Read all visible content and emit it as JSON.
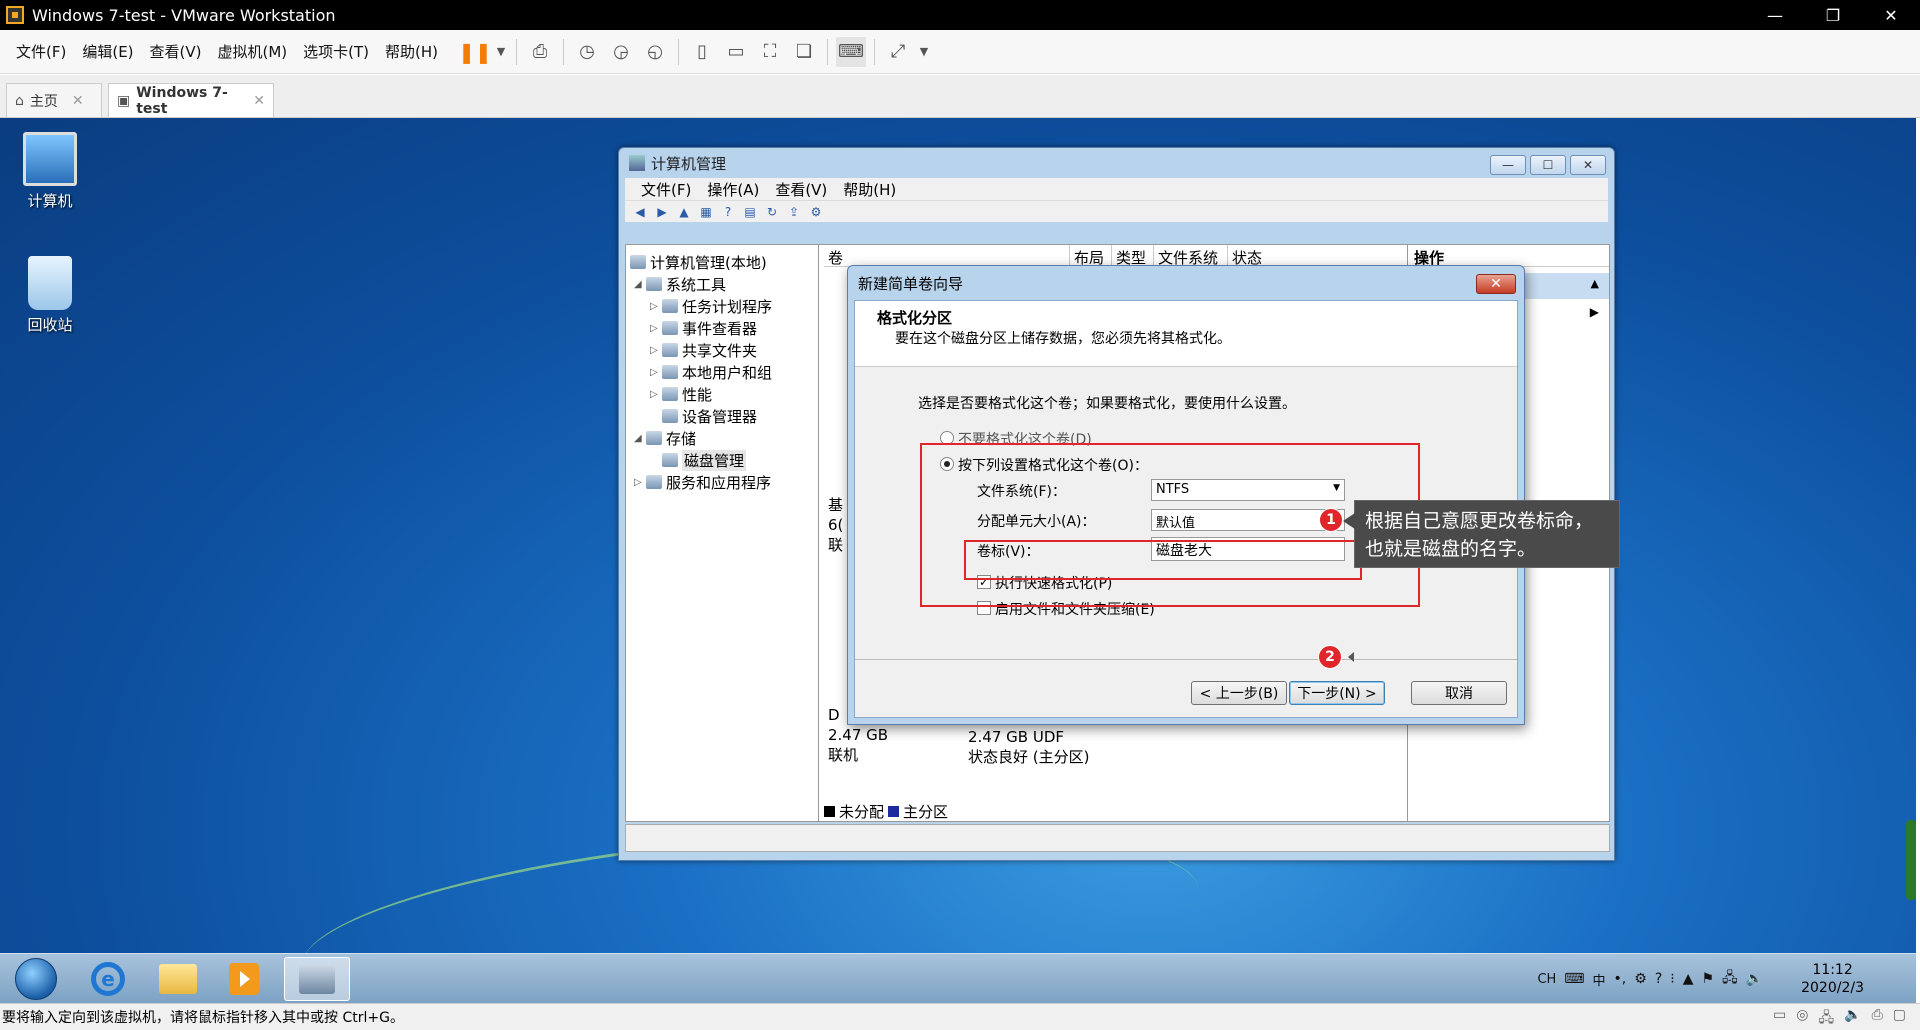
{
  "vmware": {
    "title": "Windows 7-test - VMware Workstation",
    "menu": [
      "文件(F)",
      "编辑(E)",
      "查看(V)",
      "虚拟机(M)",
      "选项卡(T)",
      "帮助(H)"
    ],
    "tabs": {
      "home": "主页",
      "vm": "Windows 7-test"
    },
    "status_message": "要将输入定向到该虚拟机，请将鼠标指针移入其中或按 Ctrl+G。"
  },
  "desktop": {
    "icons": {
      "computer": "计算机",
      "recycle_bin": "回收站"
    }
  },
  "taskbar": {
    "tray_lang": "CH",
    "ime": "中",
    "time": "11:12",
    "date": "2020/2/3"
  },
  "cm": {
    "title": "计算机管理",
    "menu": [
      "文件(F)",
      "操作(A)",
      "查看(V)",
      "帮助(H)"
    ],
    "tree": {
      "root": "计算机管理(本地)",
      "system_tools": "系统工具",
      "task_scheduler": "任务计划程序",
      "event_viewer": "事件查看器",
      "shared_folders": "共享文件夹",
      "local_users": "本地用户和组",
      "performance": "性能",
      "device_manager": "设备管理器",
      "storage": "存储",
      "disk_management": "磁盘管理",
      "services_apps": "服务和应用程序"
    },
    "columns": [
      "卷",
      "布局",
      "类型",
      "文件系统",
      "状态"
    ],
    "actions_header": "操作",
    "disk": {
      "left_frag_a": "基",
      "left_frag_b": "6(",
      "left_frag_c": "联",
      "left_frag_d": "D",
      "size": "2.47 GB",
      "online": "联机",
      "udf": "2.47 GB UDF",
      "healthy": "状态良好 (主分区)"
    },
    "legend": {
      "unallocated": "未分配",
      "primary": "主分区"
    },
    "colors": {
      "unallocated": "#000000",
      "primary": "#1c2a9e"
    }
  },
  "wizard": {
    "title": "新建简单卷向导",
    "close": "✕",
    "header_title": "格式化分区",
    "header_desc": "要在这个磁盘分区上储存数据，您必须先将其格式化。",
    "prompt": "选择是否要格式化这个卷；如果要格式化，要使用什么设置。",
    "opt_no_format": "不要格式化这个卷(D)",
    "opt_format": "按下列设置格式化这个卷(O)：",
    "fs_label": "文件系统(F)：",
    "fs_value": "NTFS",
    "alloc_label": "分配单元大小(A)：",
    "alloc_value": "默认值",
    "vol_label": "卷标(V)：",
    "vol_value": "磁盘老大",
    "quick_format": "执行快速格式化(P)",
    "compress": "启用文件和文件夹压缩(E)",
    "btn_back": "< 上一步(B)",
    "btn_next": "下一步(N) >",
    "btn_cancel": "取消"
  },
  "annotation": {
    "badge1": "1",
    "badge2": "2",
    "callout": "根据自己意愿更改卷标命，也就是磁盘的名字。",
    "color": "#e0262b"
  }
}
